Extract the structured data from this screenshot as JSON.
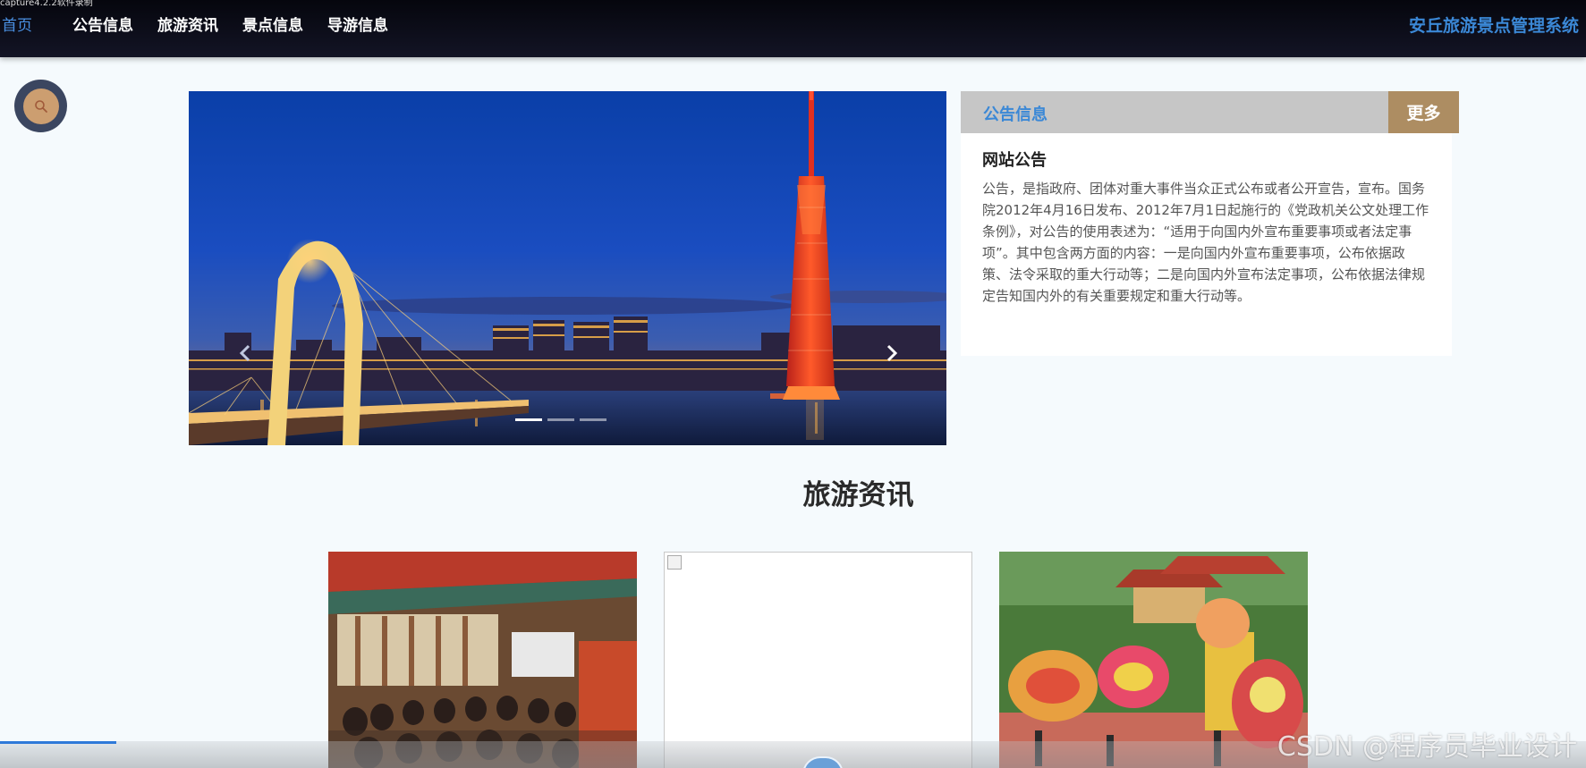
{
  "capture_label": "capture4.2.2软件录制",
  "nav": {
    "items": [
      {
        "label": "首页",
        "active": true
      },
      {
        "label": "公告信息",
        "active": false
      },
      {
        "label": "旅游资讯",
        "active": false
      },
      {
        "label": "景点信息",
        "active": false
      },
      {
        "label": "导游信息",
        "active": false
      }
    ],
    "site_title": "安丘旅游景点管理系统"
  },
  "search": {
    "icon": "search-icon"
  },
  "carousel": {
    "prev_icon": "chevron-left-icon",
    "next_icon": "chevron-right-icon",
    "indicators": 3,
    "active_index": 0
  },
  "notice": {
    "header_title": "公告信息",
    "more_label": "更多",
    "title": "网站公告",
    "body": "公告，是指政府、团体对重大事件当众正式公布或者公开宣告，宣布。国务院2012年4月16日发布、2012年7月1日起施行的《党政机关公文处理工作条例》，对公告的使用表述为：“适用于向国内外宣布重要事项或者法定事项”。其中包含两方面的内容：一是向国内外宣布重要事项，公布依据政策、法令采取的重大行动等；二是向国内外宣布法定事项，公布依据法律规定告知国内外的有关重要规定和重大行动等。"
  },
  "news_section": {
    "title": "旅游资讯",
    "cards": [
      {
        "image": "lecture-hall-photo"
      },
      {
        "image": "broken-image"
      },
      {
        "image": "lion-dance-photo"
      }
    ]
  },
  "watermark": "CSDN @程序员毕业设计",
  "colors": {
    "nav_bg": "#0b0c18",
    "accent_blue": "#3b88d6",
    "more_btn": "#ad8d62",
    "search_outer": "#3b4660",
    "search_inner": "#cc9e70"
  }
}
